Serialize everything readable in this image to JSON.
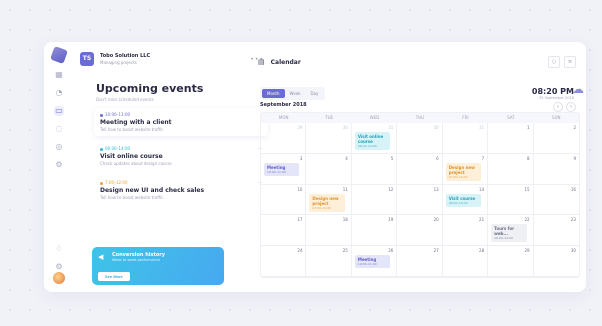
{
  "org": {
    "badge": "TS",
    "name": "Tobo Solution LLC",
    "subtitle": "Managing projects",
    "more": "•••"
  },
  "rail_icons": [
    "cube-logo",
    "calendar-icon",
    "chart-icon",
    "folder-icon",
    "chat-icon",
    "users-icon",
    "settings-icon",
    "bell-icon",
    "gear-icon",
    "avatar"
  ],
  "events_panel": {
    "title": "Upcoming events",
    "subtitle": "Don't miss scheduled events",
    "events": [
      {
        "time": "10:00–11:00",
        "title": "Meeting with a client",
        "desc": "Tell how to boost website traffic",
        "color": "purple"
      },
      {
        "time": "06:00–14:00",
        "title": "Visit online course",
        "desc": "Check updates about design course",
        "color": "teal"
      },
      {
        "time": "7:00–12:00",
        "title": "Design new UI and check sales",
        "desc": "Tell how to boost website traffic",
        "color": "orange"
      }
    ]
  },
  "promo": {
    "title": "Conversion history",
    "subtitle": "Week to week performance",
    "button": "See More"
  },
  "calendar": {
    "title": "Calendar",
    "tabs": [
      "Month",
      "Week",
      "Day"
    ],
    "active_tab": "Month",
    "month_label": "September 2018",
    "time": "08:20 PM",
    "date_text": "25 September 2018",
    "weekdays": [
      "MON",
      "TUE",
      "WED",
      "THU",
      "FRI",
      "SAT",
      "SUN"
    ],
    "weeks": [
      [
        {
          "n": "29",
          "out": true
        },
        {
          "n": "30",
          "out": true
        },
        {
          "n": "31",
          "out": true,
          "ev": {
            "t": "Visit online course",
            "d": "06:00–14:00",
            "c": "teal"
          }
        },
        {
          "n": "30",
          "out": true
        },
        {
          "n": "31",
          "out": true
        },
        {
          "n": "1"
        },
        {
          "n": "2"
        }
      ],
      [
        {
          "n": "3",
          "ev": {
            "t": "Meeting",
            "d": "10:00–11:00",
            "c": "purple"
          }
        },
        {
          "n": "4"
        },
        {
          "n": "5"
        },
        {
          "n": "6"
        },
        {
          "n": "7",
          "ev": {
            "t": "Design new project",
            "d": "07:00–12:00",
            "c": "orange"
          }
        },
        {
          "n": "8"
        },
        {
          "n": "9"
        }
      ],
      [
        {
          "n": "10"
        },
        {
          "n": "11",
          "ev": {
            "t": "Design new project",
            "d": "07:00–12:00",
            "c": "orange"
          }
        },
        {
          "n": "12"
        },
        {
          "n": "13"
        },
        {
          "n": "14",
          "ev": {
            "t": "Visit course",
            "d": "06:00–14:00",
            "c": "teal"
          }
        },
        {
          "n": "15"
        },
        {
          "n": "16"
        }
      ],
      [
        {
          "n": "17"
        },
        {
          "n": "18"
        },
        {
          "n": "19"
        },
        {
          "n": "20"
        },
        {
          "n": "21"
        },
        {
          "n": "22",
          "ev": {
            "t": "Tours for web...",
            "d": "10:00–12:00",
            "c": "gray"
          }
        },
        {
          "n": "23"
        }
      ],
      [
        {
          "n": "24"
        },
        {
          "n": "25"
        },
        {
          "n": "26",
          "ev": {
            "t": "Meeting",
            "d": "10:00–11:00",
            "c": "purple"
          }
        },
        {
          "n": "27"
        },
        {
          "n": "28"
        },
        {
          "n": "29"
        },
        {
          "n": "30"
        }
      ]
    ]
  }
}
